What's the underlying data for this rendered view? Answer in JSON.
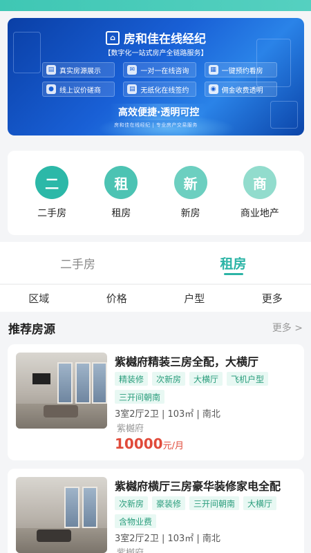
{
  "banner": {
    "title": "房和佳在线经纪",
    "subtitle": "【数字化一站式房产全链路服务】",
    "features": [
      "真实房源展示",
      "一对一在线咨询",
      "一键预约看房",
      "线上议价磋商",
      "无纸化在线签约",
      "佣金收费透明"
    ],
    "slogan": "高效便捷·透明可控",
    "footer": "房和佳在线经纪 | 专业房产交易服务"
  },
  "categories": [
    {
      "glyph": "二",
      "label": "二手房",
      "color": "#2cb8a8"
    },
    {
      "glyph": "租",
      "label": "租房",
      "color": "#4cc3b3"
    },
    {
      "glyph": "新",
      "label": "新房",
      "color": "#6ccfc0"
    },
    {
      "glyph": "商",
      "label": "商业地产",
      "color": "#92dccd"
    }
  ],
  "tabs": [
    {
      "label": "二手房",
      "active": false
    },
    {
      "label": "租房",
      "active": true
    }
  ],
  "filters": [
    "区域",
    "价格",
    "户型",
    "更多"
  ],
  "recommend": {
    "title": "推荐房源",
    "more": "更多 >"
  },
  "listings": [
    {
      "title": "紫樾府精装三房全配，大横厅",
      "tags": [
        "精装修",
        "次新房",
        "大横厅",
        "飞机户型",
        "三开间朝南"
      ],
      "info": "3室2厅2卫 | 103㎡ | 南北",
      "community": "紫樾府",
      "price": "10000",
      "price_unit": "元/月"
    },
    {
      "title": "紫樾府横厅三房豪华装修家电全配",
      "tags": [
        "次新房",
        "豪装修",
        "三开间朝南",
        "大横厅",
        "含物业费"
      ],
      "info": "3室2厅2卫 | 103㎡ | 南北",
      "community": "紫樾府"
    }
  ],
  "colors": {
    "accent": "#2cb4a6",
    "price": "#e04a3a",
    "tag_bg": "#e8f8f3",
    "tag_text": "#2a9d7c"
  }
}
